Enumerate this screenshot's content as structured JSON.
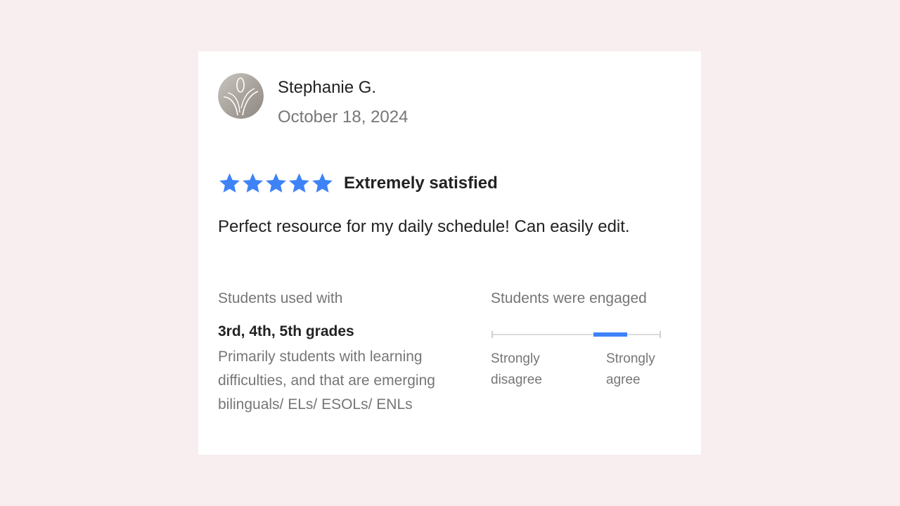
{
  "review": {
    "reviewer_name": "Stephanie G.",
    "date": "October 18, 2024",
    "rating": 5,
    "rating_max": 5,
    "rating_label": "Extremely satisfied",
    "text": "Perfect resource for my daily schedule! Can easily edit.",
    "avatar_icon": "avatar-logo-icon",
    "star_icon": "star-icon",
    "star_color": "#3e82f7"
  },
  "students_used_with": {
    "heading": "Students used with",
    "grades": "3rd, 4th, 5th grades",
    "description": "Primarily students with learning difficulties, and that are emerging bilinguals/ ELs/ ESOLs/ ENLs"
  },
  "engagement": {
    "heading": "Students were engaged",
    "min_label": "Strongly disagree",
    "max_label": "Strongly agree",
    "scale_points": 5,
    "selected_point": 4,
    "bar_color": "#3e82f7"
  },
  "colors": {
    "page_background": "#f8eeef",
    "card_background": "#ffffff",
    "text_primary": "#222222",
    "text_secondary": "#767676"
  }
}
